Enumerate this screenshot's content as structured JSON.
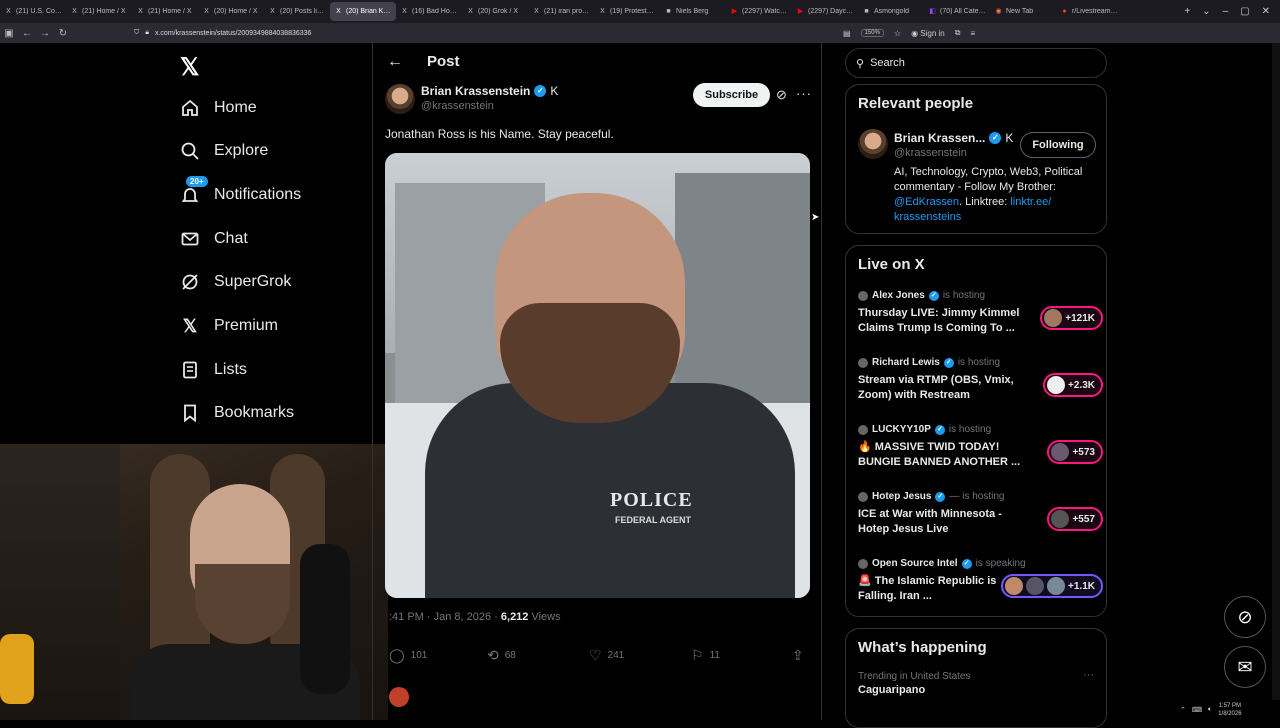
{
  "browser": {
    "tabs": [
      {
        "label": "(21) U.S. Coast G",
        "icon": "x-logo-icon"
      },
      {
        "label": "(21) Home / X",
        "icon": "x-logo-icon"
      },
      {
        "label": "(21) Home / X",
        "icon": "x-logo-icon"
      },
      {
        "label": "(20) Home / X",
        "icon": "x-logo-icon"
      },
      {
        "label": "(20) Posts liked b",
        "icon": "x-logo-icon"
      },
      {
        "label": "(20) Brian Kras",
        "icon": "x-logo-icon",
        "active": true
      },
      {
        "label": "(16) Bad Hombre",
        "icon": "x-logo-icon"
      },
      {
        "label": "(20) Grok / X",
        "icon": "x-logo-icon"
      },
      {
        "label": "(21) iran protest",
        "icon": "x-logo-icon"
      },
      {
        "label": "(19) Protests Sur",
        "icon": "x-logo-icon"
      },
      {
        "label": "Niels Berg",
        "icon": "generic-icon"
      },
      {
        "label": "(2297) Watch las",
        "icon": "youtube-icon"
      },
      {
        "label": "(2297) Daycare h",
        "icon": "youtube-icon"
      },
      {
        "label": "Asmongold",
        "icon": "generic-icon"
      },
      {
        "label": "(70) All Categorie",
        "icon": "twitch-icon"
      },
      {
        "label": "New Tab",
        "icon": "firefox-icon"
      },
      {
        "label": "r/LivestreamFail",
        "icon": "reddit-icon"
      }
    ],
    "url": "x.com/krassenstein/status/2009349884038836336",
    "zoom": "150%",
    "signin": "Sign in"
  },
  "leftnav": {
    "items": [
      {
        "label": "Home",
        "icon": "home-icon"
      },
      {
        "label": "Explore",
        "icon": "search-icon"
      },
      {
        "label": "Notifications",
        "icon": "bell-icon",
        "badge": "20+"
      },
      {
        "label": "Chat",
        "icon": "mail-icon"
      },
      {
        "label": "SuperGrok",
        "icon": "grok-icon"
      },
      {
        "label": "Premium",
        "icon": "x-logo-icon"
      },
      {
        "label": "Lists",
        "icon": "list-icon"
      },
      {
        "label": "Bookmarks",
        "icon": "bookmark-icon"
      }
    ]
  },
  "post": {
    "header_title": "Post",
    "author_name": "Brian Krassenstein",
    "author_handle": "@krassenstein",
    "subscribe_label": "Subscribe",
    "text": "Jonathan Ross is his Name.  Stay peaceful.",
    "media_text": "POLICE",
    "media_subtext": "FEDERAL AGENT",
    "time": ":41 PM · Jan 8, 2026 · ",
    "views": "6,212",
    "views_label": " Views",
    "replies": "101",
    "reposts": "68",
    "likes": "241",
    "bookmarks": "11"
  },
  "right": {
    "search_placeholder": "Search",
    "relevant_title": "Relevant people",
    "person": {
      "name": "Brian Krassen...",
      "handle": "@krassenstein",
      "follow_label": "Following",
      "bio": "AI, Technology, Crypto, Web3, Political commentary - Follow My Brother: ",
      "bio_mention": "@EdKrassen",
      "bio_mid": ". Linktree: ",
      "bio_link": "linktr.ee/ krassensteins"
    },
    "live_title": "Live on X",
    "live": [
      {
        "host": "Alex Jones",
        "status": "is hosting",
        "title": "Thursday LIVE: Jimmy Kimmel Claims Trump Is Coming To ...",
        "count": "+121K",
        "style": "pink"
      },
      {
        "host": "Richard Lewis",
        "status": "is hosting",
        "title": "Stream via RTMP (OBS, Vmix, Zoom) with Restream",
        "count": "+2.3K",
        "style": "pink"
      },
      {
        "host": "LUCKYY10P",
        "status": "is hosting",
        "title": "🔥 MASSIVE TWID TODAY! BUNGIE BANNED ANOTHER ...",
        "count": "+573",
        "style": "pink"
      },
      {
        "host": "Hotep Jesus",
        "status": "— is hosting",
        "title": "ICE at War with Minnesota - Hotep Jesus Live",
        "count": "+557",
        "style": "pink"
      },
      {
        "host": "Open Source Intel",
        "status": "is speaking",
        "title": "🚨 The Islamic Republic is Falling. Iran ...",
        "count": "+1.1K",
        "style": "purple"
      }
    ],
    "happening_title": "What’s happening",
    "trend_label": "Trending in United States",
    "trend_name": "Caguaripano"
  },
  "taskbar": {
    "time": "1:57 PM",
    "date": "1/8/2026"
  },
  "colors": {
    "accent": "#1d9bf0",
    "live_pink": "#f91880",
    "live_purple": "#7856ff"
  }
}
